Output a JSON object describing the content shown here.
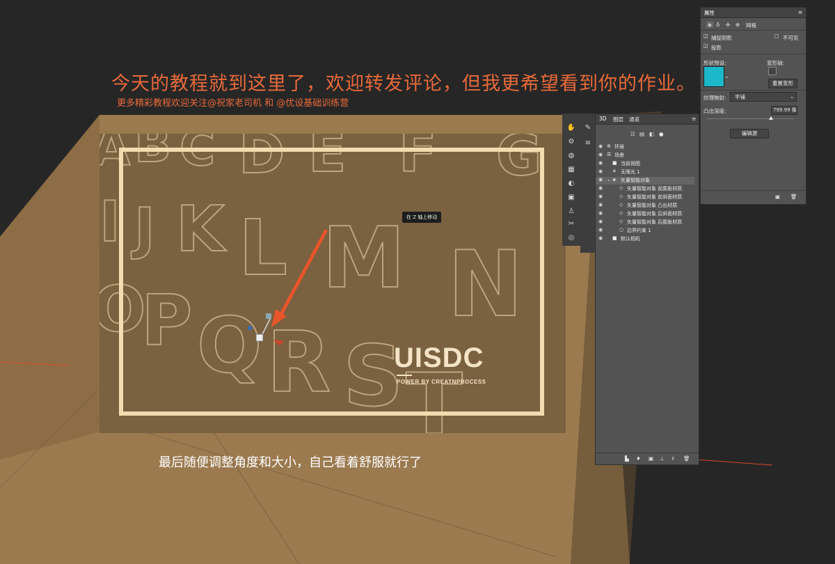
{
  "tutorial": {
    "headline": "今天的教程就到这里了，欢迎转发评论，但我更希望看到你的作业。",
    "subline": "更多精彩教程欢迎关注@祝家老司机 和 @优设基础训练营",
    "caption": "最后随便调整角度和大小，自己看着舒服就行了"
  },
  "artwork": {
    "brand": "UISDC",
    "tagline": "POWER BY CREATNPROCESS",
    "letters": [
      "A",
      "B",
      "C",
      "D",
      "E",
      "F",
      "G",
      "I",
      "J",
      "K",
      "L",
      "M",
      "N",
      "O",
      "P",
      "Q",
      "R",
      "S",
      "T"
    ],
    "tooltip": "在 Z 轴上移动",
    "colors": {
      "background": "#7a6140",
      "frame": "#f2dcb0",
      "arrow": "#e8552a"
    }
  },
  "layers_panel": {
    "tabs": [
      "3D",
      "图层",
      "通道"
    ],
    "rows": [
      {
        "label": "环境",
        "icon": "environment-icon"
      },
      {
        "label": "场景",
        "icon": "scene-icon"
      },
      {
        "label": "当前视图",
        "icon": "camera-icon"
      },
      {
        "label": "无限光 1",
        "icon": "light-icon"
      },
      {
        "label": "矢量智能对象",
        "icon": "mesh-icon"
      },
      {
        "label": "矢量智能对象 前膨胀材质",
        "icon": "material-icon"
      },
      {
        "label": "矢量智能对象 前斜面材质",
        "icon": "material-icon"
      },
      {
        "label": "矢量智能对象 凸出材质",
        "icon": "material-icon"
      },
      {
        "label": "矢量智能对象 后斜面材质",
        "icon": "material-icon"
      },
      {
        "label": "矢量智能对象 后膨胀材质",
        "icon": "material-icon"
      },
      {
        "label": "边界约束 1",
        "icon": "constraint-icon"
      },
      {
        "label": "默认相机",
        "icon": "camera-icon"
      }
    ]
  },
  "properties_panel": {
    "title": "属性",
    "mesh_tab": "网格",
    "catch_shadows": "捕捉阴影",
    "cast_shadows": "投影",
    "invisible": "不可见",
    "shape_preset": "形状预设:",
    "deform_axis": "变形轴:",
    "reset_deform": "重置变形",
    "texture_mapping_label": "纹理映射:",
    "texture_mapping_value": "平铺",
    "extrusion_depth_label": "凸出深度:",
    "extrusion_depth_value": "799.99 像",
    "edit_source": "编辑源",
    "preset_color": "#1ab8c8"
  }
}
